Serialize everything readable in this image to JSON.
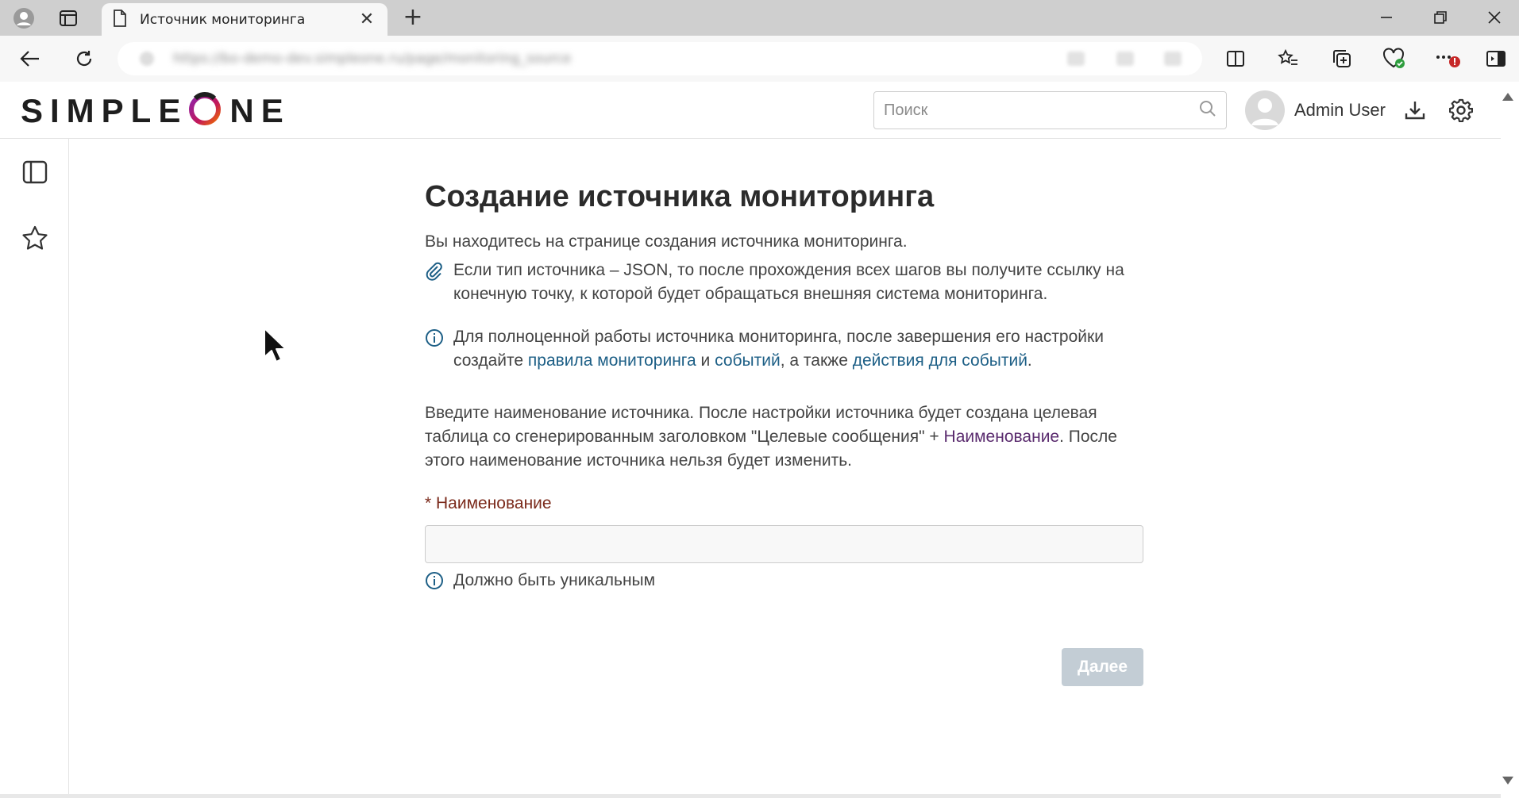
{
  "browser": {
    "tab_title": "Источник мониторинга",
    "new_tab": "+",
    "close_tab": "✕",
    "url": "https://bo-demo-dev.simpleone.ru/page/monitoring_source"
  },
  "header": {
    "logo": "SIMPLEONE",
    "search_placeholder": "Поиск",
    "user_name": "Admin User"
  },
  "main": {
    "title": "Создание источника мониторинга",
    "intro": "Вы находитесь на странице создания источника мониторинга.",
    "json_note": "Если тип источника – JSON, то после прохождения всех шагов вы получите ссылку на конечную точку, к которой будет обращаться внешняя система мониторинга.",
    "info": {
      "t1": "Для полноценной работы источника мониторинга, после завершения его настройки создайте ",
      "link1": "правила мониторинга",
      "t2": " и ",
      "link2": "событий",
      "t3": ", а также ",
      "link3": "действия для событий",
      "t4": "."
    },
    "enter": {
      "t1": "Введите наименование источника. После настройки источника будет создана целевая таблица со сгенерированным заголовком \"Целевые сообщения\" + ",
      "link": "Наименование",
      "t2": ". После этого наименование источника нельзя будет изменить."
    },
    "field_label": "* Наименование",
    "field_value": "",
    "hint": "Должно быть уникальным",
    "next_button": "Далее"
  },
  "colors": {
    "link": "#1d5f86",
    "label": "#7b2a1b",
    "button_disabled": "#c3cdd5",
    "logo_accent": "#c2185b"
  }
}
